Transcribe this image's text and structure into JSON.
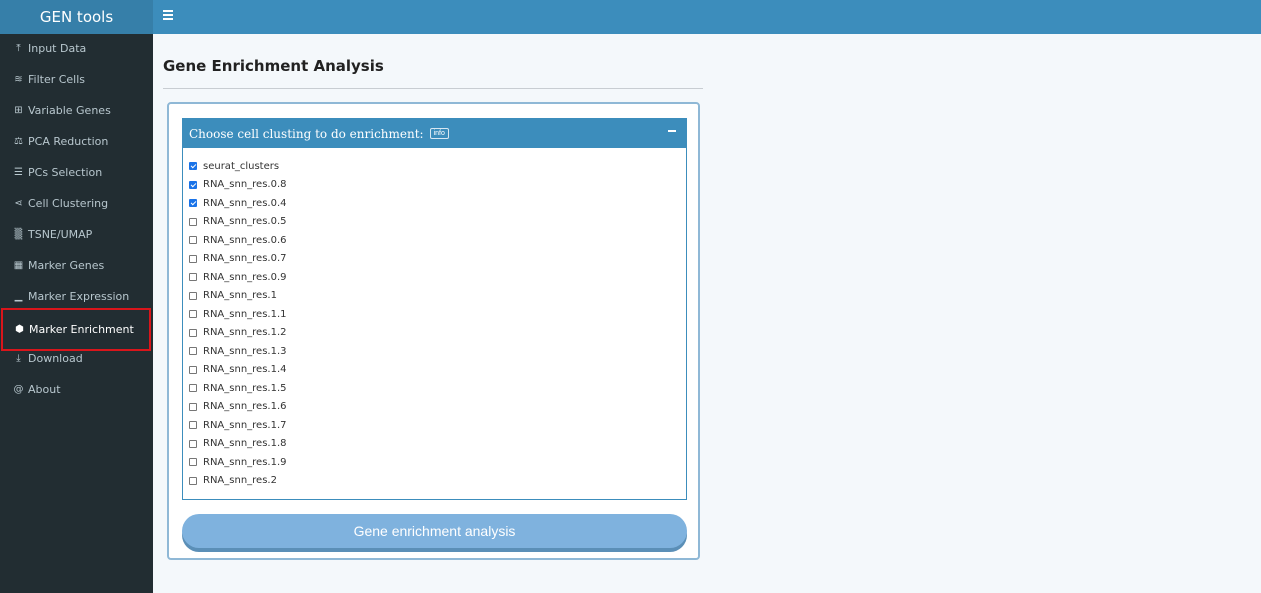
{
  "app": {
    "title": "GEN tools"
  },
  "sidebar": {
    "items": [
      {
        "label": "Input Data",
        "icon": "upload-icon",
        "glyph": "⤒"
      },
      {
        "label": "Filter Cells",
        "icon": "layers-icon",
        "glyph": "≋"
      },
      {
        "label": "Variable Genes",
        "icon": "grid-icon",
        "glyph": "⊞"
      },
      {
        "label": "PCA Reduction",
        "icon": "balance-icon",
        "glyph": "⚖"
      },
      {
        "label": "PCs Selection",
        "icon": "list-icon",
        "glyph": "☰"
      },
      {
        "label": "Cell Clustering",
        "icon": "share-icon",
        "glyph": "⋖"
      },
      {
        "label": "TSNE/UMAP",
        "icon": "dots-icon",
        "glyph": "▒"
      },
      {
        "label": "Marker Genes",
        "icon": "table-icon",
        "glyph": "▦"
      },
      {
        "label": "Marker Expression",
        "icon": "chart-icon",
        "glyph": "▁"
      },
      {
        "label": "Marker Enrichment",
        "icon": "cube-icon",
        "glyph": "⬢"
      },
      {
        "label": "Download",
        "icon": "download-icon",
        "glyph": "⤓"
      },
      {
        "label": "About",
        "icon": "at-icon",
        "glyph": "@"
      }
    ],
    "active_index": 9
  },
  "main": {
    "title": "Gene Enrichment Analysis",
    "panel": {
      "header": "Choose cell clusting to do enrichment:",
      "info_label": "info",
      "options": [
        {
          "label": "seurat_clusters",
          "checked": true
        },
        {
          "label": "RNA_snn_res.0.8",
          "checked": true
        },
        {
          "label": "RNA_snn_res.0.4",
          "checked": true
        },
        {
          "label": "RNA_snn_res.0.5",
          "checked": false
        },
        {
          "label": "RNA_snn_res.0.6",
          "checked": false
        },
        {
          "label": "RNA_snn_res.0.7",
          "checked": false
        },
        {
          "label": "RNA_snn_res.0.9",
          "checked": false
        },
        {
          "label": "RNA_snn_res.1",
          "checked": false
        },
        {
          "label": "RNA_snn_res.1.1",
          "checked": false
        },
        {
          "label": "RNA_snn_res.1.2",
          "checked": false
        },
        {
          "label": "RNA_snn_res.1.3",
          "checked": false
        },
        {
          "label": "RNA_snn_res.1.4",
          "checked": false
        },
        {
          "label": "RNA_snn_res.1.5",
          "checked": false
        },
        {
          "label": "RNA_snn_res.1.6",
          "checked": false
        },
        {
          "label": "RNA_snn_res.1.7",
          "checked": false
        },
        {
          "label": "RNA_snn_res.1.8",
          "checked": false
        },
        {
          "label": "RNA_snn_res.1.9",
          "checked": false
        },
        {
          "label": "RNA_snn_res.2",
          "checked": false
        }
      ]
    },
    "action_button": "Gene enrichment analysis"
  },
  "colors": {
    "header": "#3c8dbc",
    "brand": "#367fa9",
    "sidebar": "#222d32",
    "active_outline": "#d9151b",
    "button": "#7fb2de"
  }
}
